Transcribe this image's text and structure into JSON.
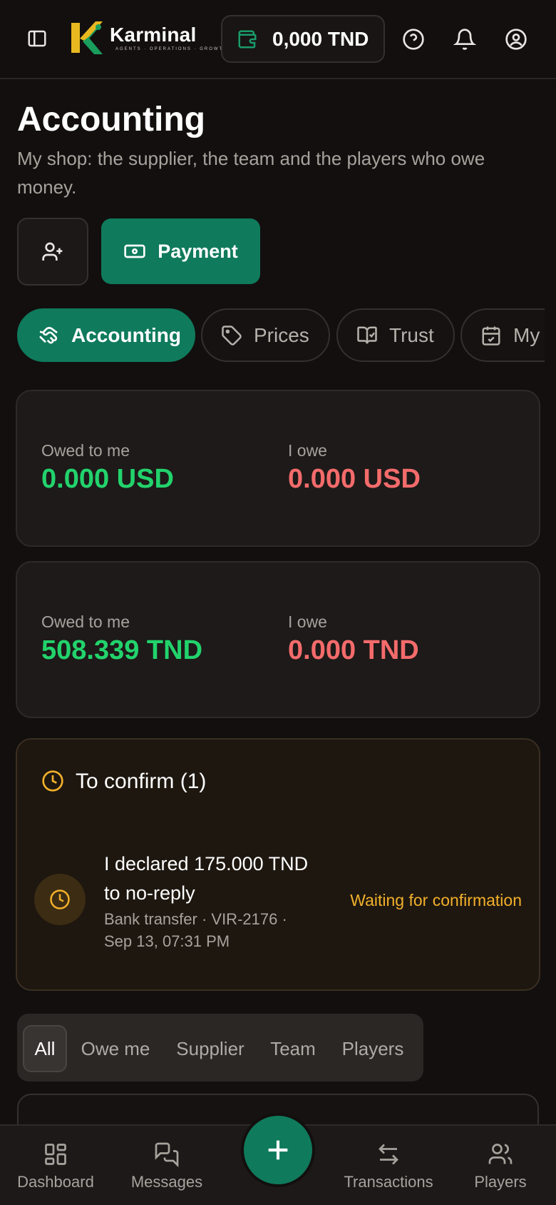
{
  "header": {
    "brand_name": "Karminal",
    "brand_tagline": "AGENTS · OPERATIONS · GROWTH",
    "wallet_balance": "0,000 TND"
  },
  "page": {
    "title": "Accounting",
    "subtitle": "My shop: the supplier, the team and the players who owe money."
  },
  "actions": {
    "payment_label": "Payment"
  },
  "tabs": [
    {
      "label": "Accounting",
      "icon": "handshake-icon",
      "active": true
    },
    {
      "label": "Prices",
      "icon": "tag-icon",
      "active": false
    },
    {
      "label": "Trust",
      "icon": "book-check-icon",
      "active": false
    },
    {
      "label": "My",
      "icon": "calendar-check-icon",
      "active": false
    }
  ],
  "balances": [
    {
      "owed_label": "Owed to me",
      "owed_value": "0.000 USD",
      "owe_label": "I owe",
      "owe_value": "0.000 USD"
    },
    {
      "owed_label": "Owed to me",
      "owed_value": "508.339 TND",
      "owe_label": "I owe",
      "owe_value": "0.000 TND"
    }
  ],
  "to_confirm": {
    "title": "To confirm (1)",
    "items": [
      {
        "title": "I declared 175.000 TND to no-reply",
        "meta": "Bank transfer · VIR-2176 · Sep 13, 07:31 PM",
        "status": "Waiting for confirmation"
      }
    ]
  },
  "filters": [
    {
      "label": "All",
      "active": true
    },
    {
      "label": "Owe me",
      "active": false
    },
    {
      "label": "Supplier",
      "active": false
    },
    {
      "label": "Team",
      "active": false
    },
    {
      "label": "Players",
      "active": false
    }
  ],
  "bottom_nav": [
    {
      "label": "Dashboard",
      "icon": "dashboard-icon"
    },
    {
      "label": "Messages",
      "icon": "messages-icon"
    },
    {
      "label": "Transactions",
      "icon": "transfer-icon"
    },
    {
      "label": "Players",
      "icon": "users-icon"
    }
  ],
  "colors": {
    "accent": "#0f7a5c",
    "positive": "#22d36c",
    "negative": "#f46b6b",
    "warning": "#f2b02a"
  }
}
